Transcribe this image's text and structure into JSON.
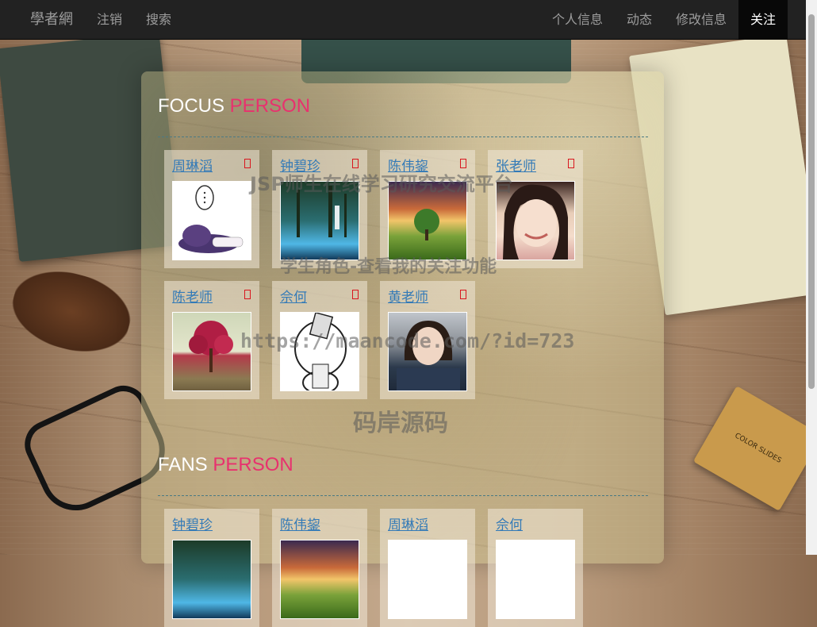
{
  "navbar": {
    "brand": "學者網",
    "left_links": [
      "注销",
      "搜索"
    ],
    "right_links": [
      "个人信息",
      "动态",
      "修改信息",
      "关注"
    ],
    "active": "关注"
  },
  "focus_section": {
    "title_plain": "FOCUS ",
    "title_accent": "PERSON",
    "people": [
      {
        "name": "周琳滔",
        "avatar": "anime-sleeping"
      },
      {
        "name": "钟碧珍",
        "avatar": "forest-lake"
      },
      {
        "name": "陈伟鋆",
        "avatar": "tree-sunset"
      },
      {
        "name": "张老师",
        "avatar": "smiling-girl"
      },
      {
        "name": "陈老师",
        "avatar": "red-tree"
      },
      {
        "name": "佘何",
        "avatar": "sketch-character"
      },
      {
        "name": "黄老师",
        "avatar": "student-girl"
      }
    ]
  },
  "fans_section": {
    "title_plain": "FANS ",
    "title_accent": "PERSON",
    "people": [
      {
        "name": "钟碧珍",
        "avatar": "forest-lake"
      },
      {
        "name": "陈伟鋆",
        "avatar": "tree-sunset"
      },
      {
        "name": "周琳滔",
        "avatar": "anime-sleeping"
      },
      {
        "name": "佘何",
        "avatar": "sketch-character"
      }
    ]
  },
  "watermarks": {
    "line1": "JSP师生在线学习研究交流平台",
    "line2": "学生角色-查看我的关注功能",
    "line3": "https://maancode.com/?id=723",
    "line4": "码岸源码"
  },
  "background": {
    "slides_label": "COLOR SLIDES"
  },
  "colors": {
    "accent": "#e8316e",
    "link": "#337ab7",
    "navbar_bg": "#222222",
    "delete_icon": "#d9161e"
  }
}
